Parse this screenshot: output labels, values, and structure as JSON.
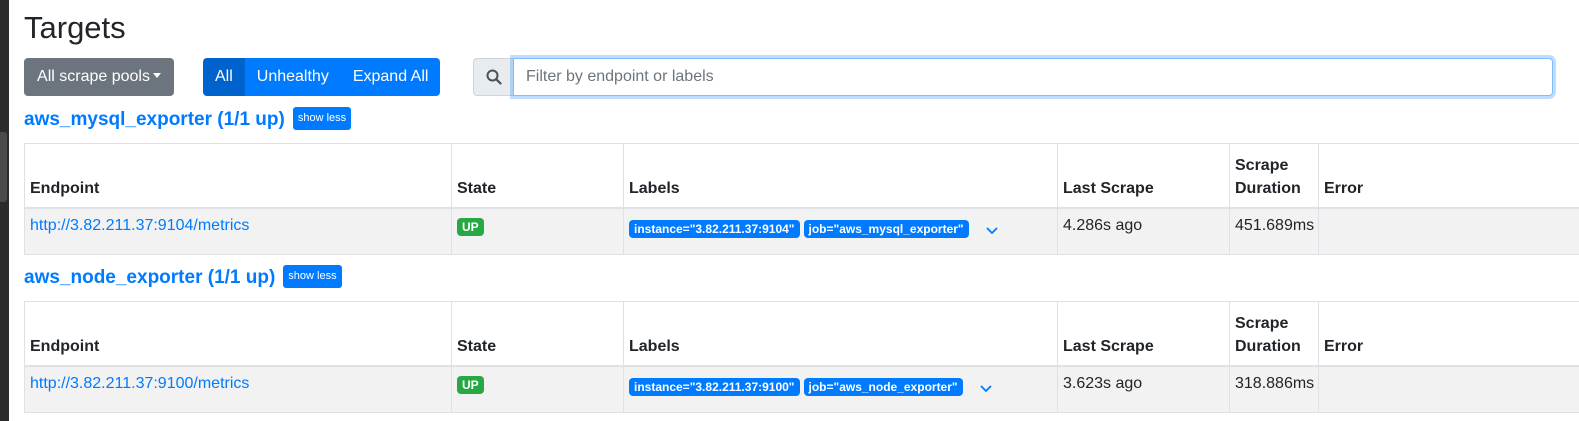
{
  "page": {
    "title": "Targets"
  },
  "toolbar": {
    "pools_label": "All scrape pools",
    "filter_buttons": [
      "All",
      "Unhealthy",
      "Expand All"
    ],
    "search_placeholder": "Filter by endpoint or labels",
    "search_value": ""
  },
  "columns": [
    "Endpoint",
    "State",
    "Labels",
    "Last Scrape",
    "Scrape Duration",
    "Error"
  ],
  "pools": [
    {
      "title": "aws_mysql_exporter (1/1 up)",
      "toggle_label": "show less",
      "rows": [
        {
          "endpoint": "http://3.82.211.37:9104/metrics",
          "state": "UP",
          "labels": [
            "instance=\"3.82.211.37:9104\"",
            "job=\"aws_mysql_exporter\""
          ],
          "last_scrape": "4.286s ago",
          "scrape_duration": "451.689ms",
          "error": ""
        }
      ]
    },
    {
      "title": "aws_node_exporter (1/1 up)",
      "toggle_label": "show less",
      "rows": [
        {
          "endpoint": "http://3.82.211.37:9100/metrics",
          "state": "UP",
          "labels": [
            "instance=\"3.82.211.37:9100\"",
            "job=\"aws_node_exporter\""
          ],
          "last_scrape": "3.623s ago",
          "scrape_duration": "318.886ms",
          "error": ""
        }
      ]
    }
  ],
  "colors": {
    "primary": "#007bff",
    "primary_active": "#0062cc",
    "secondary": "#6c757d",
    "success": "#28a745",
    "row_bg": "#f2f2f2"
  }
}
